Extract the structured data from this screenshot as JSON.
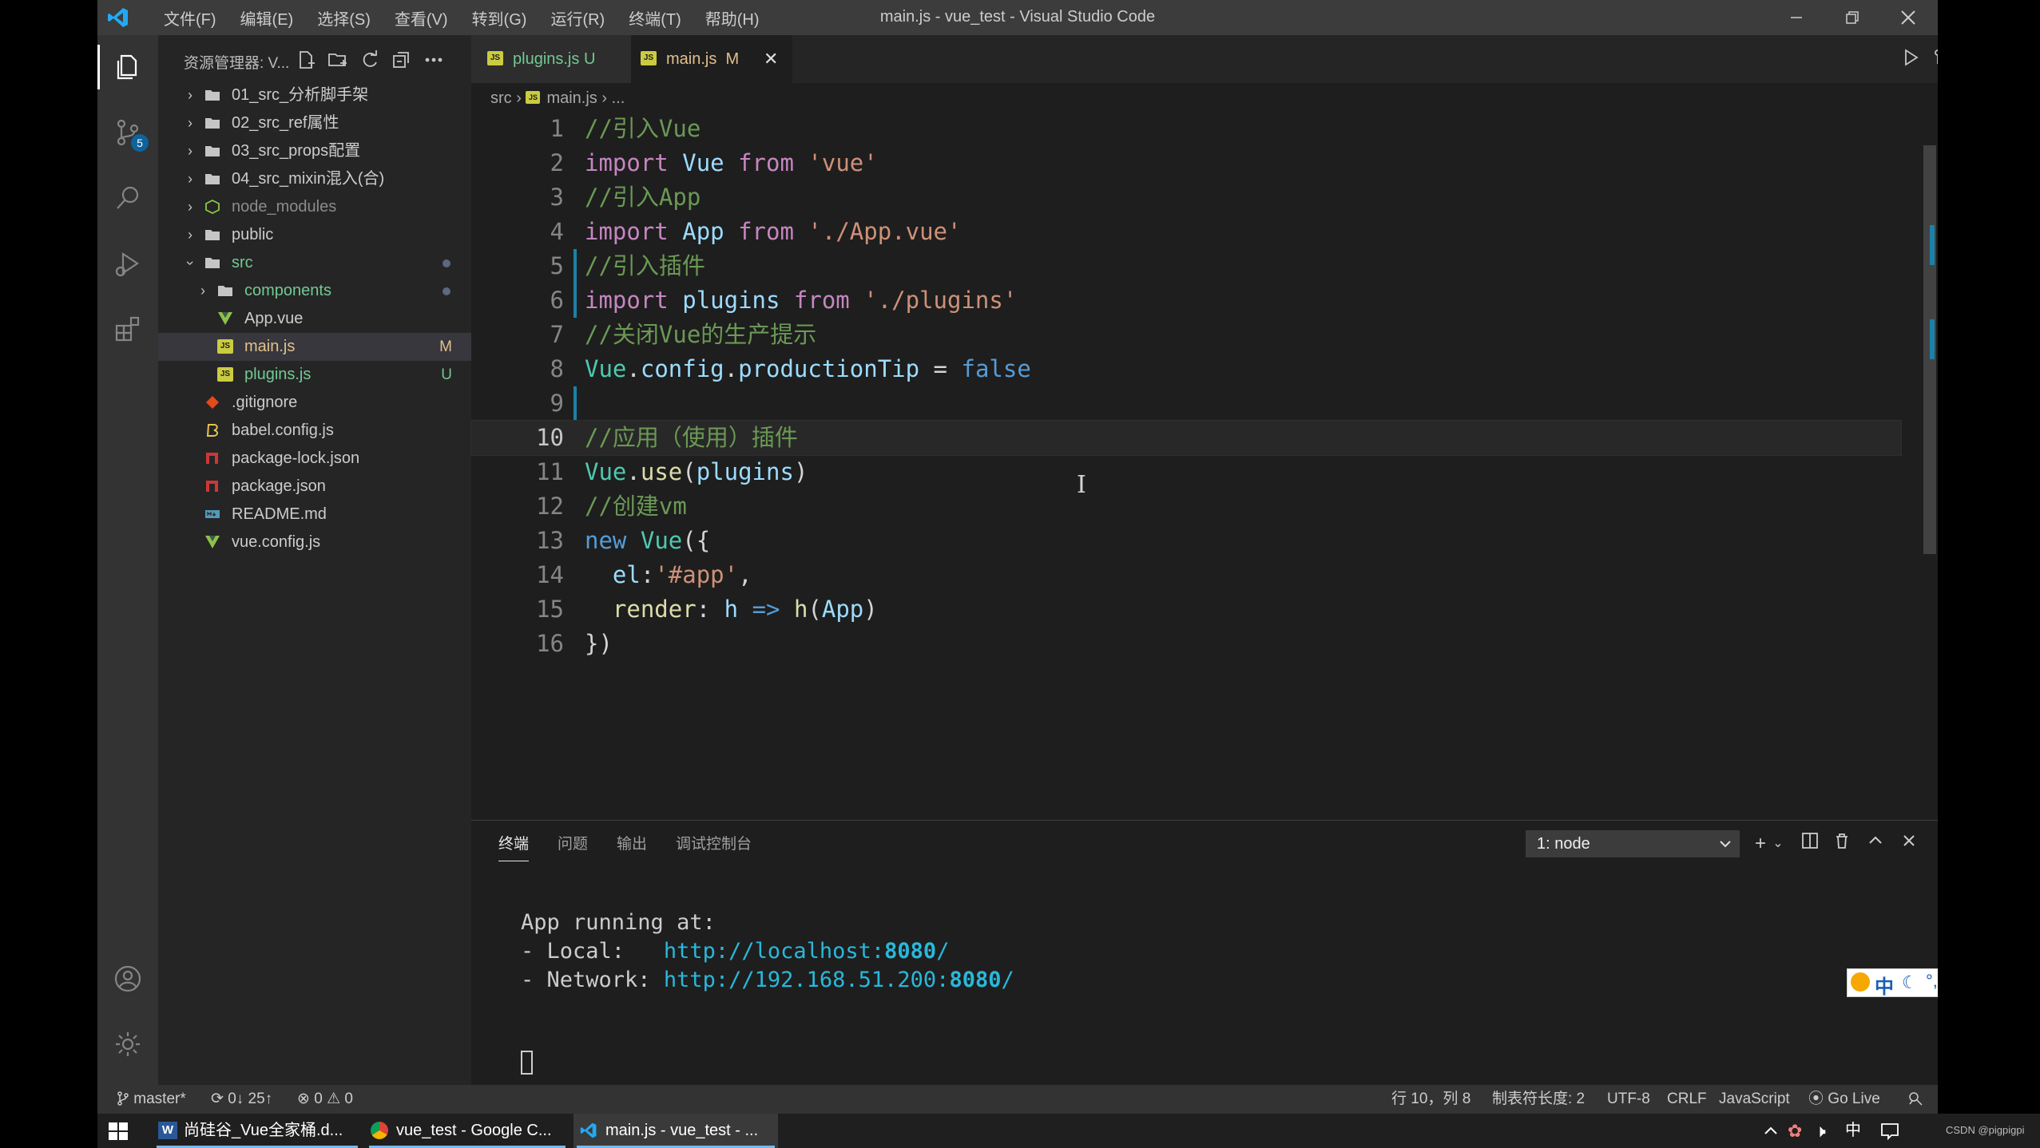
{
  "window": {
    "title": "main.js - vue_test - Visual Studio Code",
    "menu": [
      "文件(F)",
      "编辑(E)",
      "选择(S)",
      "查看(V)",
      "转到(G)",
      "运行(R)",
      "终端(T)",
      "帮助(H)"
    ]
  },
  "activity_bar": {
    "scm_badge": "5"
  },
  "explorer": {
    "title": "资源管理器: V...",
    "items": [
      {
        "label": "01_src_分析脚手架",
        "type": "folder",
        "expanded": false
      },
      {
        "label": "02_src_ref属性",
        "type": "folder",
        "expanded": false
      },
      {
        "label": "03_src_props配置",
        "type": "folder",
        "expanded": false
      },
      {
        "label": "04_src_mixin混入(合)",
        "type": "folder",
        "expanded": false
      },
      {
        "label": "node_modules",
        "type": "folder",
        "expanded": false
      },
      {
        "label": "public",
        "type": "folder",
        "expanded": false
      },
      {
        "label": "src",
        "type": "folder",
        "expanded": true
      },
      {
        "label": "components",
        "type": "folder",
        "expanded": false
      },
      {
        "label": "App.vue",
        "type": "vue"
      },
      {
        "label": "main.js",
        "type": "js",
        "decoration": "M"
      },
      {
        "label": "plugins.js",
        "type": "js",
        "decoration": "U"
      },
      {
        "label": ".gitignore",
        "type": "git"
      },
      {
        "label": "babel.config.js",
        "type": "babel"
      },
      {
        "label": "package-lock.json",
        "type": "npm"
      },
      {
        "label": "package.json",
        "type": "npm"
      },
      {
        "label": "README.md",
        "type": "md"
      },
      {
        "label": "vue.config.js",
        "type": "vue"
      }
    ]
  },
  "tabs": [
    {
      "label": "plugins.js",
      "status": "U",
      "active": false
    },
    {
      "label": "main.js",
      "status": "M",
      "active": true,
      "close": "✕"
    }
  ],
  "breadcrumb": {
    "folder": "src",
    "file": "main.js",
    "more": "..."
  },
  "code": {
    "line_numbers": [
      "1",
      "2",
      "3",
      "4",
      "5",
      "6",
      "7",
      "8",
      "9",
      "10",
      "11",
      "12",
      "13",
      "14",
      "15",
      "16"
    ],
    "lines": [
      "//引入Vue",
      "import Vue from 'vue'",
      "//引入App",
      "import App from './App.vue'",
      "//引入插件",
      "import plugins from './plugins'",
      "//关闭Vue的生产提示",
      "Vue.config.productionTip = false",
      "",
      "//应用（使用）插件",
      "Vue.use(plugins)",
      "//创建vm",
      "new Vue({",
      "  el:'#app',",
      "  render: h => h(App)",
      "})"
    ]
  },
  "panel": {
    "tabs": [
      "终端",
      "问题",
      "输出",
      "调试控制台"
    ],
    "terminal_select": "1: node",
    "terminal_lines": {
      "running": "App running at:",
      "local_label": "- Local:   ",
      "local_url": "http://localhost:",
      "local_port": "8080",
      "local_slash": "/",
      "network_label": "- Network: ",
      "network_url": "http://192.168.51.200:",
      "network_port": "8080",
      "network_slash": "/"
    }
  },
  "status_bar": {
    "branch": "master*",
    "sync": "0↓ 25↑",
    "errors": "0",
    "warnings": "0",
    "position": "行 10，列 8",
    "indent": "制表符长度: 2",
    "encoding": "UTF-8",
    "eol": "CRLF",
    "language": "JavaScript",
    "golive": "Go Live"
  },
  "taskbar": {
    "items": [
      {
        "label": "尚硅谷_Vue全家桶.d...",
        "app": "word"
      },
      {
        "label": "vue_test - Google C...",
        "app": "chrome"
      },
      {
        "label": "main.js - vue_test - ...",
        "app": "vscode"
      }
    ],
    "ime_char": "中",
    "watermark": "CSDN @pigpigpi"
  },
  "colors": {
    "accent": "#007acc",
    "statusbar": "#333333",
    "git_modified": "#e2c08d",
    "git_untracked": "#73c991"
  }
}
